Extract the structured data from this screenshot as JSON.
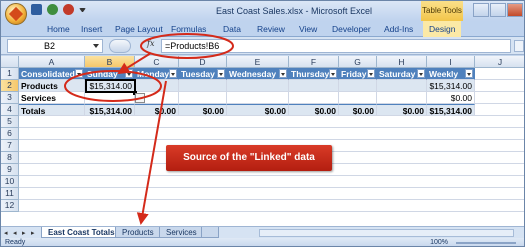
{
  "window": {
    "title": "East Coast Sales.xlsx - Microsoft Excel",
    "context_tab": "Table Tools"
  },
  "ribbon": {
    "tabs": [
      "Home",
      "Insert",
      "Page Layout",
      "Formulas",
      "Data",
      "Review",
      "View",
      "Developer",
      "Add-Ins",
      "Design"
    ]
  },
  "formula_bar": {
    "name_box": "B2",
    "fx_label": "fx",
    "formula": "=Products!B6"
  },
  "grid": {
    "columns": [
      "A",
      "B",
      "C",
      "D",
      "E",
      "F",
      "G",
      "H",
      "I",
      "J"
    ],
    "rows": [
      "1",
      "2",
      "3",
      "4",
      "5",
      "6",
      "7",
      "8",
      "9",
      "10",
      "11",
      "12"
    ],
    "header_row": [
      "Consolidated",
      "Sunday",
      "Monday",
      "Tuesday",
      "Wednesday",
      "Thursday",
      "Friday",
      "Saturday",
      "Weekly"
    ],
    "data_rows": [
      [
        "Products",
        "$15,314.00",
        "",
        "",
        "",
        "",
        "",
        "",
        "$15,314.00"
      ],
      [
        "Services",
        "",
        "",
        "",
        "",
        "",
        "",
        "",
        "$0.00"
      ],
      [
        "Totals",
        "$15,314.00",
        "$0.00",
        "$0.00",
        "$0.00",
        "$0.00",
        "$0.00",
        "$0.00",
        "$15,314.00"
      ]
    ]
  },
  "sheet_tabs": [
    "East Coast Totals",
    "Products",
    "Services"
  ],
  "status": {
    "ready": "Ready",
    "zoom": "100%"
  },
  "annotation": {
    "callout": "Source of the \"Linked\" data",
    "color": "#d42a1a"
  }
}
